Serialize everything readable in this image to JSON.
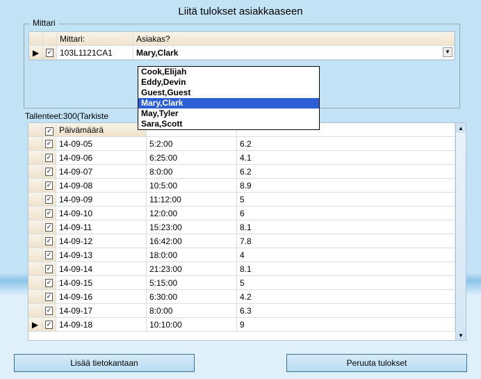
{
  "title": "Liitä tulokset asiakkaaseen",
  "mittari_box": {
    "legend": "Mittari",
    "headers": {
      "mittari": "Mittari:",
      "asiakas": "Asiakas?"
    },
    "row": {
      "checked": true,
      "mittari": "103L1121CA1",
      "selected": "Mary,Clark"
    },
    "options": [
      "Cook,Elijah",
      "Eddy,Devin",
      "Guest,Guest",
      "Mary,Clark",
      "May,Tyler",
      "Sara,Scott"
    ],
    "highlighted": "Mary,Clark"
  },
  "tallenteet_label": "Tallenteet:300(Tarkiste",
  "data": {
    "header_date": "Päivämäärä",
    "rows": [
      {
        "checked": true,
        "date": "14-09-05",
        "time": "5:2:00",
        "val": "6.2"
      },
      {
        "checked": true,
        "date": "14-09-06",
        "time": "6:25:00",
        "val": "4.1"
      },
      {
        "checked": true,
        "date": "14-09-07",
        "time": "8:0:00",
        "val": "6.2"
      },
      {
        "checked": true,
        "date": "14-09-08",
        "time": "10:5:00",
        "val": "8.9"
      },
      {
        "checked": true,
        "date": "14-09-09",
        "time": "11:12:00",
        "val": "5"
      },
      {
        "checked": true,
        "date": "14-09-10",
        "time": "12:0:00",
        "val": "6"
      },
      {
        "checked": true,
        "date": "14-09-11",
        "time": "15:23:00",
        "val": "8.1"
      },
      {
        "checked": true,
        "date": "14-09-12",
        "time": "16:42:00",
        "val": "7.8"
      },
      {
        "checked": true,
        "date": "14-09-13",
        "time": "18:0:00",
        "val": "4"
      },
      {
        "checked": true,
        "date": "14-09-14",
        "time": "21:23:00",
        "val": "8.1"
      },
      {
        "checked": true,
        "date": "14-09-15",
        "time": "5:15:00",
        "val": "5"
      },
      {
        "checked": true,
        "date": "14-09-16",
        "time": "6:30:00",
        "val": "4.2"
      },
      {
        "checked": true,
        "date": "14-09-17",
        "time": "8:0:00",
        "val": "6.3"
      },
      {
        "checked": true,
        "date": "14-09-18",
        "time": "10:10:00",
        "val": "9",
        "marker": true
      }
    ]
  },
  "buttons": {
    "add": "Lisää tietokantaan",
    "cancel": "Peruuta tulokset"
  },
  "glyphs": {
    "check": "✓",
    "marker": "▶",
    "arrow_down": "▼",
    "arrow_up": "▲"
  }
}
